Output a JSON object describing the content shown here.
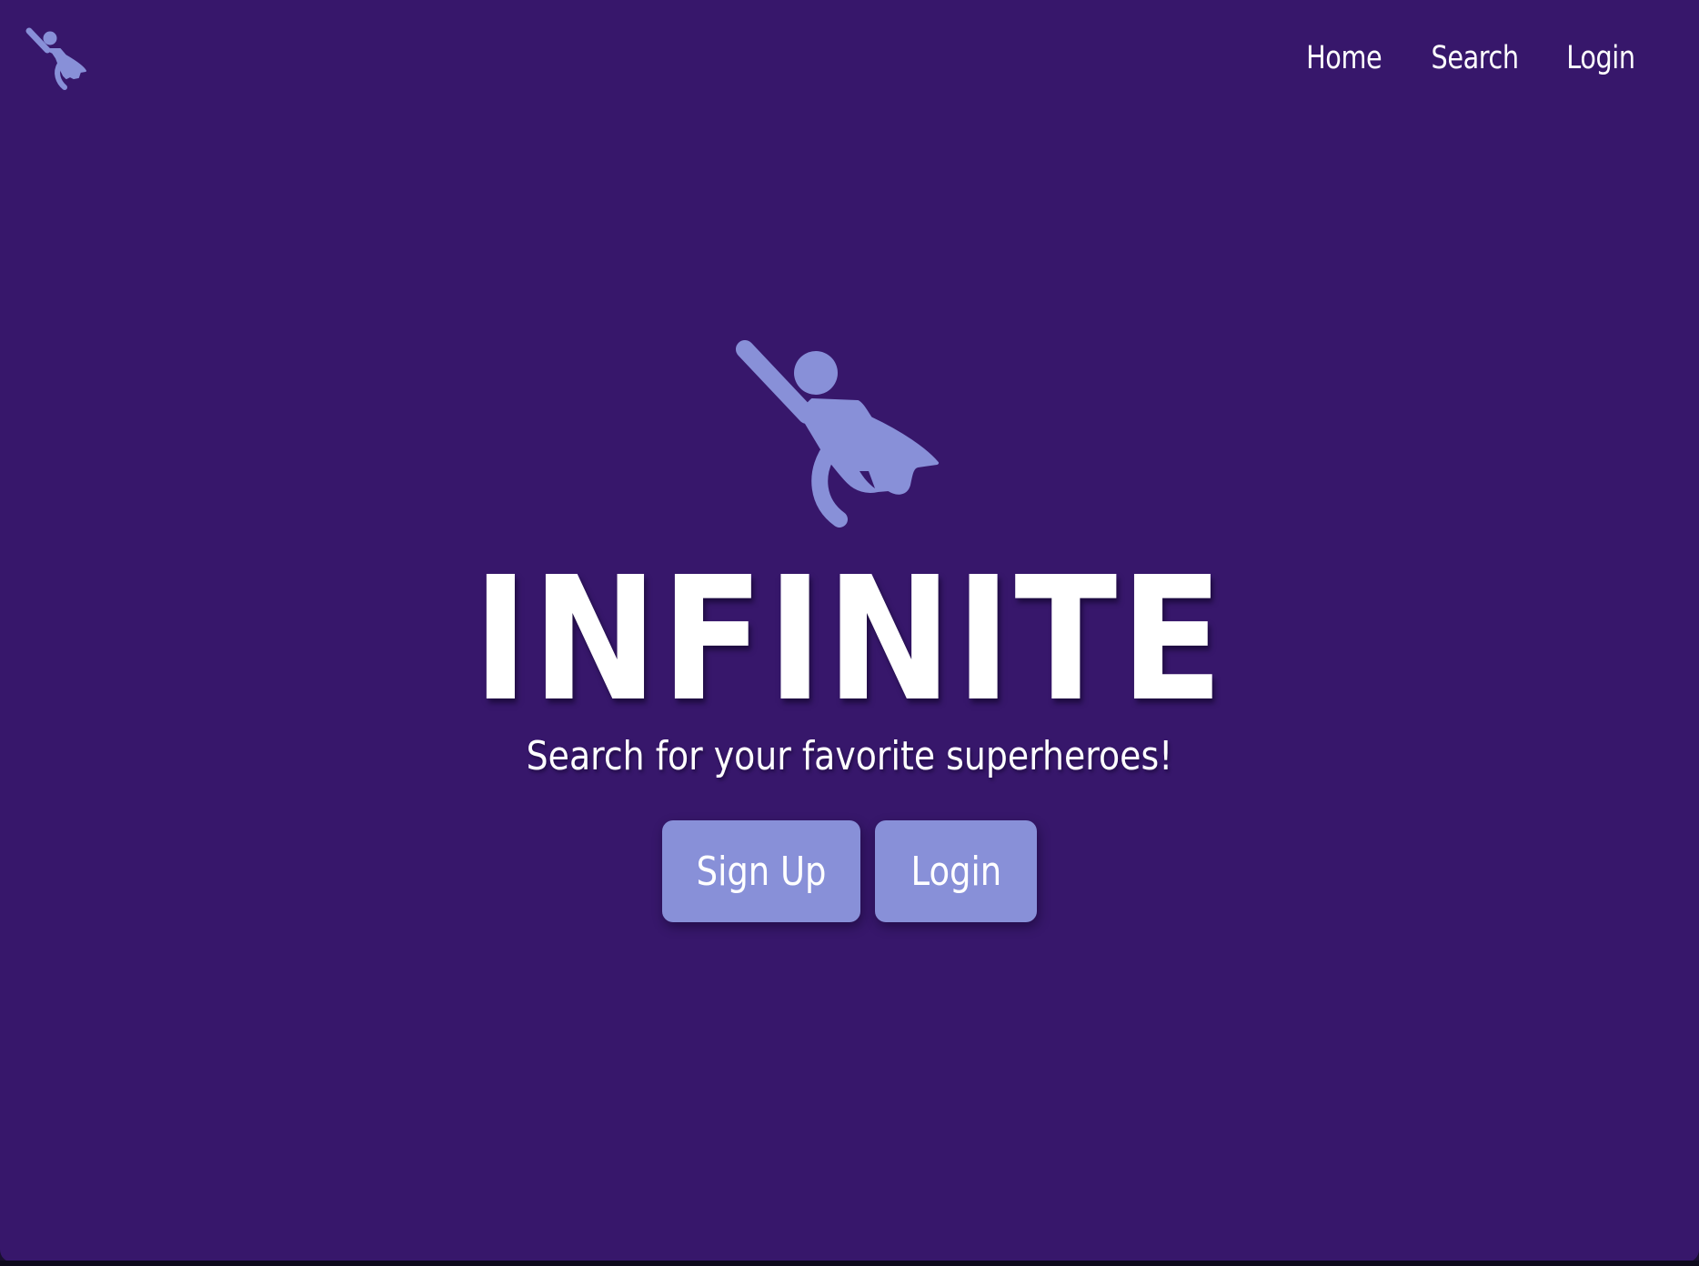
{
  "brand": {
    "logo_icon": "flying-superhero-icon",
    "title": "INFINITE",
    "tagline": "Search for your favorite superheroes!"
  },
  "nav": {
    "items": [
      {
        "label": "Home"
      },
      {
        "label": "Search"
      },
      {
        "label": "Login"
      }
    ]
  },
  "cta": {
    "signup_label": "Sign Up",
    "login_label": "Login"
  },
  "colors": {
    "background": "#37176b",
    "accent": "#8890d8",
    "text": "#ffffff"
  }
}
